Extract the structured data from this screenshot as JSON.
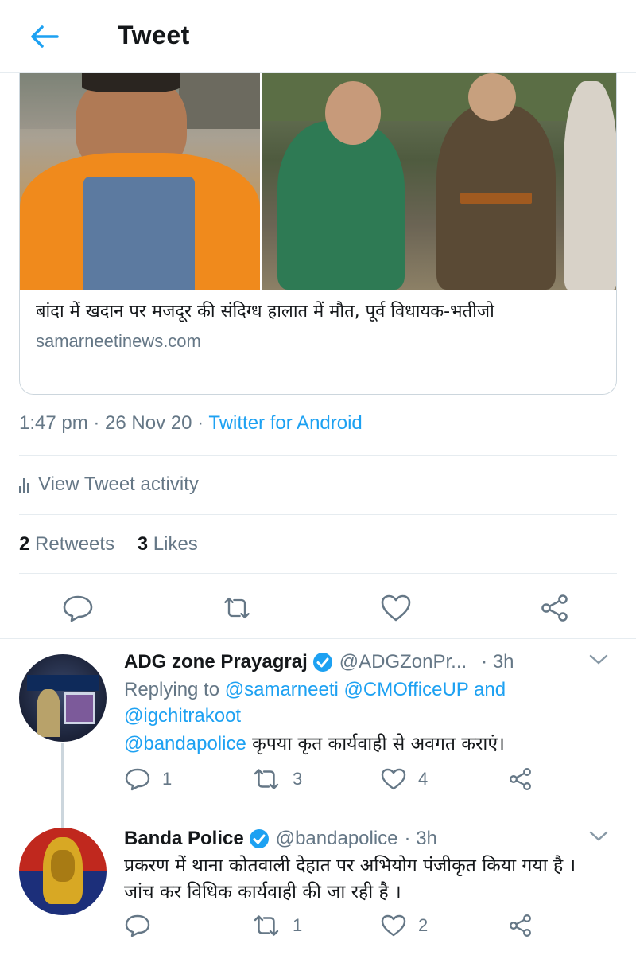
{
  "header": {
    "title": "Tweet",
    "back_icon": "arrow-left-icon",
    "accent": "#1da1f2"
  },
  "card": {
    "title": "बांदा में खदान पर मजदूर की संदिग्ध हालात में मौत, पूर्व विधायक-भतीजो",
    "domain": "samarneetinews.com"
  },
  "meta": {
    "time": "1:47 pm",
    "sep1": " · ",
    "date": "26 Nov 20",
    "sep2": " · ",
    "source": "Twitter for Android"
  },
  "activity": {
    "label": "View Tweet activity"
  },
  "stats": {
    "retweets_count": "2",
    "retweets_label": "Retweets",
    "likes_count": "3",
    "likes_label": "Likes"
  },
  "replies": [
    {
      "name": "ADG zone Prayagraj",
      "handle": "@ADGZonPr...",
      "time": "· 3h",
      "replying_prefix": "Replying to",
      "replying_users": "@samarneeti @CMOfficeUP",
      "replying_and": "and",
      "replying_last": "@igchitrakoot",
      "text_mention": "@bandapolice",
      "text": " कृपया कृत कार्यवाही से अवगत कराएं।",
      "replies_count": "1",
      "retweets_count": "3",
      "likes_count": "4"
    },
    {
      "name": "Banda Police",
      "handle": "@bandapolice",
      "time": "· 3h",
      "text": "प्रकरण में थाना कोतवाली देहात पर अभियोग पंजीकृत किया गया है । जांच कर विधिक कार्यवाही की जा रही है ।",
      "replies_count": "",
      "retweets_count": "1",
      "likes_count": "2"
    }
  ],
  "colors": {
    "accent": "#1da1f2",
    "muted": "#657786",
    "text": "#14171a",
    "border": "#e6ecf0"
  }
}
